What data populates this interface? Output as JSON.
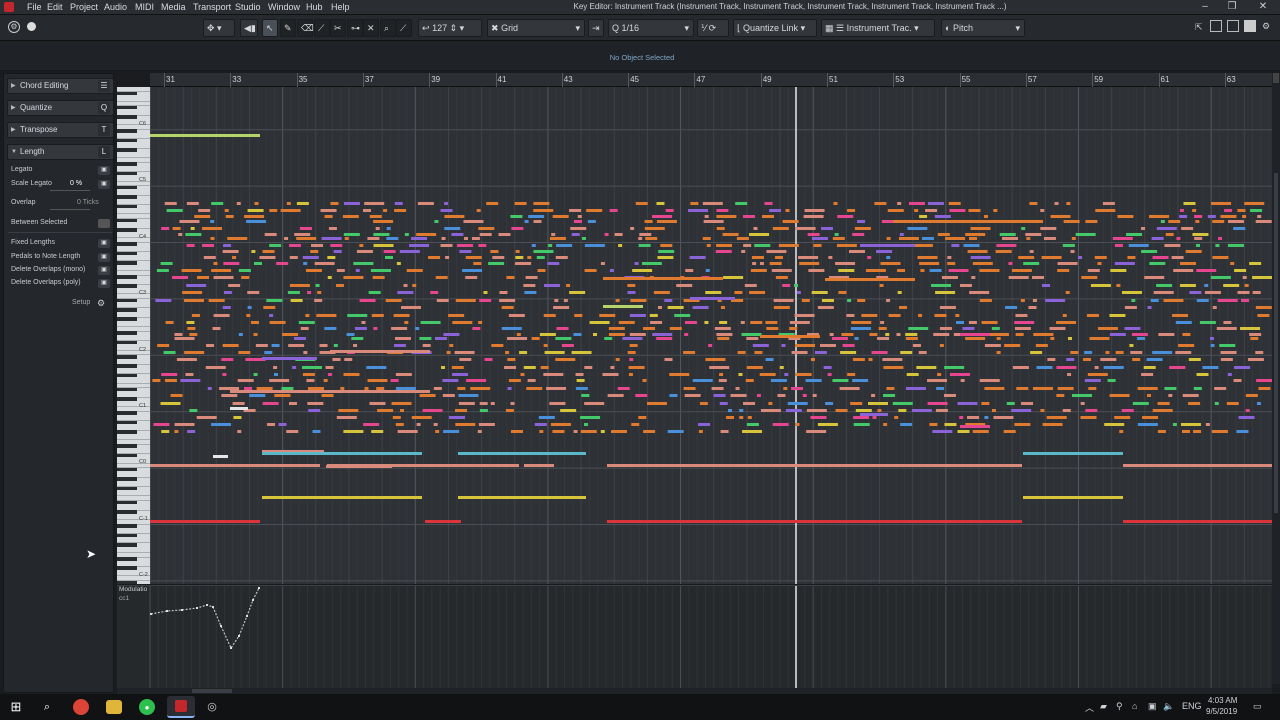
{
  "window": {
    "title": "Key Editor: Instrument Track (Instrument Track, Instrument Track, Instrument Track, Instrument Track, Instrument Track ...)",
    "menu": [
      "File",
      "Edit",
      "Project",
      "Audio",
      "MIDI",
      "Media",
      "Transport",
      "Studio",
      "Window",
      "Hub",
      "Help"
    ],
    "controls": [
      "–",
      "❐",
      "✕"
    ]
  },
  "toolbar": {
    "velocity": "127",
    "snap_mode": "Grid",
    "quantize": "1/16",
    "quantize_link": "Quantize Link",
    "track": "Instrument Trac.",
    "lane": "Pitch"
  },
  "info": {
    "selection": "No Object Selected"
  },
  "inspector": {
    "sections": [
      {
        "label": "Chord Editing",
        "icon": "☰",
        "open": false
      },
      {
        "label": "Quantize",
        "icon": "Q",
        "open": false
      },
      {
        "label": "Transpose",
        "icon": "T",
        "open": false
      },
      {
        "label": "Length",
        "icon": "L",
        "open": true
      }
    ],
    "length": {
      "legato": "Legato",
      "scale_legato": "Scale Legato",
      "scale_legato_value": "0 %",
      "overlap": "Overlap",
      "overlap_value": "0 Ticks",
      "between_selected": "Between Selected",
      "fixed_lengths": "Fixed Lengths",
      "pedals": "Pedals to Note Length",
      "delete_mono": "Delete Overlaps (mono)",
      "delete_poly": "Delete Overlaps (poly)",
      "setup": "Setup"
    }
  },
  "ruler": {
    "bars": [
      "31",
      "33",
      "35",
      "37",
      "39",
      "41",
      "43",
      "45",
      "47",
      "49",
      "51",
      "53",
      "55",
      "57",
      "59",
      "61",
      "63"
    ]
  },
  "piano": {
    "octave_labels": [
      "C6",
      "C5",
      "C4",
      "C3",
      "C2",
      "C1",
      "C0",
      "C-1",
      "C-2"
    ]
  },
  "controller": {
    "lane_name": "Modulatio",
    "cc": "cc1"
  },
  "taskbar": {
    "time": "4:03 AM",
    "date": "9/5/2019",
    "lang": "ENG",
    "notification": "1"
  },
  "colors": {
    "bg": "#2e3135",
    "pink": "#e5468f",
    "orange": "#e07a2e",
    "salmon": "#d98a7a",
    "yellow": "#d6c43a",
    "lime": "#b5d36b",
    "green": "#44c96a",
    "purple": "#8b63d9",
    "red": "#d9353a",
    "cyan": "#5bb8c9",
    "blue": "#4a8fd9",
    "white": "#e6e6e6"
  }
}
